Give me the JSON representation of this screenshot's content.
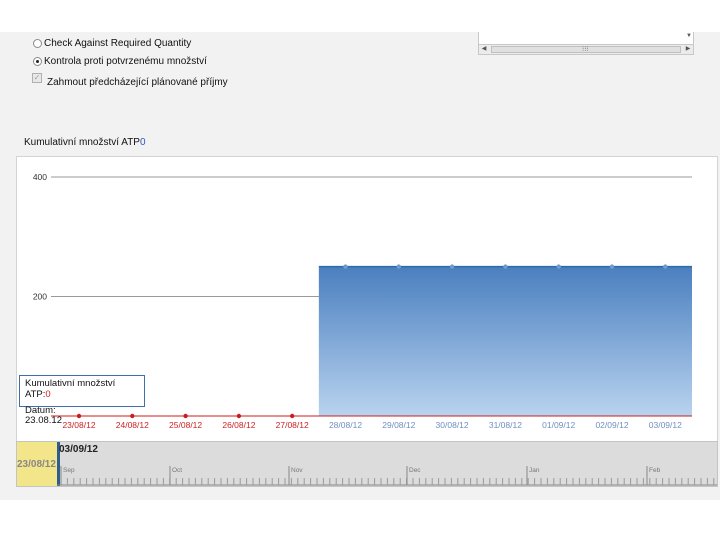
{
  "options": {
    "radio1": "Check Against Required Quantity",
    "radio2": "Kontrola proti potvrzenému množství",
    "checkbox": "Zahmout předcházející plánované příjmy"
  },
  "scroll": {
    "thumb_grip": "⁝⁝⁝"
  },
  "section": {
    "title": "Kumulativní množství ATP",
    "value": "0"
  },
  "tooltip": {
    "line1": "Kumulativní množství",
    "atp_label": "ATP:",
    "atp_value": "0",
    "date_label": "Datum:",
    "date_value": "23.08.12"
  },
  "timeline": {
    "start_label": "23/08/12",
    "current_label": "03/09/12",
    "months": [
      "Sep",
      "Oct",
      "Nov",
      "Dec",
      "Jan",
      "Feb"
    ]
  },
  "colors": {
    "past_label": "#cc2222",
    "future_label": "#6f8fbf",
    "area_top": "#4a7fbf",
    "area_bottom": "#b9d3ef",
    "marker": "#c81e1e"
  },
  "chart_data": {
    "type": "area",
    "categories": [
      "23/08/12",
      "24/08/12",
      "25/08/12",
      "26/08/12",
      "27/08/12",
      "28/08/12",
      "29/08/12",
      "30/08/12",
      "31/08/12",
      "01/09/12",
      "02/09/12",
      "03/09/12"
    ],
    "values": [
      0,
      0,
      0,
      0,
      0,
      250,
      250,
      250,
      250,
      250,
      250,
      250
    ],
    "y_ticks": [
      "200",
      "400"
    ],
    "ylim": [
      0,
      400
    ],
    "grid": true,
    "title": "",
    "xlabel": "",
    "ylabel": ""
  }
}
